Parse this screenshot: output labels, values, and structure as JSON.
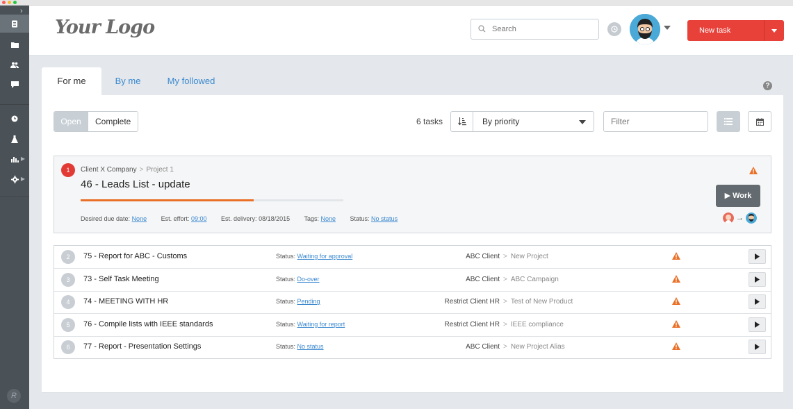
{
  "brand": {
    "logo_text": "Your Logo"
  },
  "header": {
    "search_placeholder": "Search",
    "new_task_label": "New task"
  },
  "tabs": [
    {
      "label": "For me"
    },
    {
      "label": "By me"
    },
    {
      "label": "My followed"
    }
  ],
  "help_label": "?",
  "toolbar": {
    "open_label": "Open",
    "complete_label": "Complete",
    "task_count": "6 tasks",
    "sort_label": "By priority",
    "filter_placeholder": "Filter"
  },
  "featured": {
    "number": "1",
    "client": "Client X Company",
    "separator": ">",
    "project": "Project 1",
    "title": "46 - Leads List - update",
    "progress": 0.66,
    "due_label": "Desired due date:",
    "due_value": "None",
    "effort_label": "Est. effort:",
    "effort_value": "09:00",
    "delivery_label": "Est. delivery:",
    "delivery_value": "08/18/2015",
    "tags_label": "Tags:",
    "tags_value": "None",
    "status_label": "Status:",
    "status_value": "No status",
    "work_label": "Work",
    "assign_arrow": "→"
  },
  "tasks": [
    {
      "number": "2",
      "title": "75 - Report for ABC - Customs",
      "status_label": "Status:",
      "status": "Waiting for approval",
      "client": "ABC Client",
      "separator": ">",
      "project": "New Project"
    },
    {
      "number": "3",
      "title": "73 - Self Task Meeting",
      "status_label": "Status:",
      "status": "Do-over",
      "client": "ABC Client",
      "separator": ">",
      "project": "ABC Campaign"
    },
    {
      "number": "4",
      "title": "74 - MEETING WITH HR",
      "status_label": "Status:",
      "status": "Pending",
      "client": "Restrict Client HR",
      "separator": ">",
      "project": "Test of New Product"
    },
    {
      "number": "5",
      "title": "76 - Compile lists with IEEE standards",
      "status_label": "Status:",
      "status": "Waiting for report",
      "client": "Restrict Client HR",
      "separator": ">",
      "project": "IEEE compliance"
    },
    {
      "number": "6",
      "title": "77 - Report - Presentation Settings",
      "status_label": "Status:",
      "status": "No status",
      "client": "ABC Client",
      "separator": ">",
      "project": "New Project Alias"
    }
  ],
  "colors": {
    "accent_red": "#e8413a",
    "link_blue": "#3a88cf",
    "warning_orange": "#ea7027",
    "sidebar": "#4b5257"
  }
}
